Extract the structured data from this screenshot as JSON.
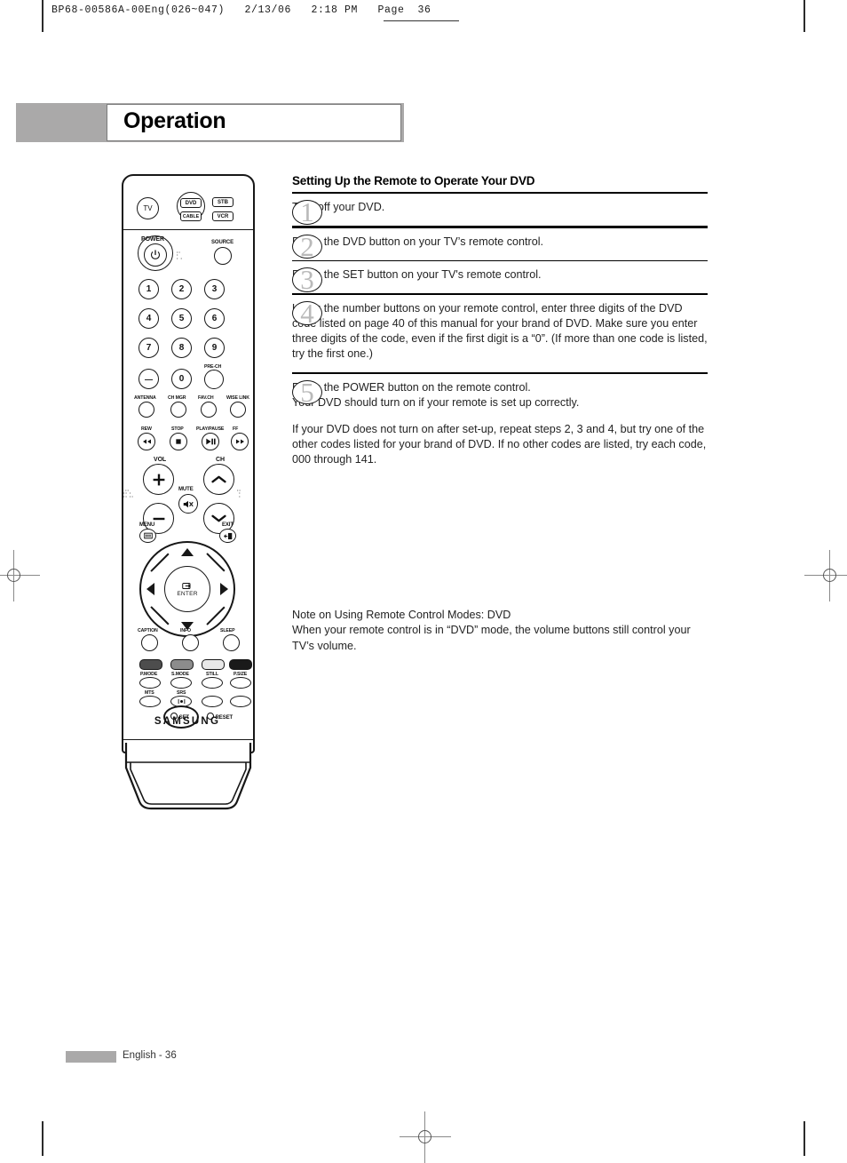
{
  "print_slug": {
    "text": "BP68-00586A-00Eng(026~047)   2/13/06   2:18 PM   Page  36"
  },
  "chapter": {
    "title": "Operation"
  },
  "section": {
    "heading": "Setting Up the Remote to Operate Your DVD",
    "steps": [
      {
        "number": "1",
        "paragraphs": [
          "Turn off your DVD."
        ]
      },
      {
        "number": "2",
        "paragraphs": [
          "Press the DVD button on your TV’s remote control."
        ]
      },
      {
        "number": "3",
        "paragraphs": [
          "Press the SET button on your TV's remote control."
        ]
      },
      {
        "number": "4",
        "paragraphs": [
          "Using the number buttons on your remote control, enter three digits of the DVD code listed on page 40 of this manual for your brand of DVD. Make sure you enter three digits of the code, even if the first digit is a “0”. (If more than one code is listed, try the first one.)"
        ]
      },
      {
        "number": "5",
        "paragraphs": [
          "Press the POWER button on the remote control.\nYour DVD should turn on if your remote is set up correctly.",
          "If your DVD does not turn on after set-up, repeat steps 2, 3 and 4, but try one of the other codes listed for your brand of DVD. If no other codes are listed, try each code, 000 through 141."
        ]
      }
    ]
  },
  "note": {
    "line1": "Note on Using Remote Control Modes: DVD",
    "line2": "When your remote control is in “DVD” mode, the volume buttons still control your TV’s volume."
  },
  "footer": {
    "page_label": "English - 36"
  },
  "remote": {
    "brand": "SAMSUNG",
    "mode_buttons": {
      "tv": "TV",
      "dvd": "DVD",
      "stb": "STB",
      "cable": "CABLE",
      "vcr": "VCR"
    },
    "power": {
      "label": "POWER",
      "icon": "power-icon"
    },
    "source": {
      "label": "SOURCE"
    },
    "keypad": [
      "1",
      "2",
      "3",
      "4",
      "5",
      "6",
      "7",
      "8",
      "9"
    ],
    "keypad_extra": {
      "minus": "—",
      "zero": "0",
      "prech": "PRE-CH"
    },
    "row_antenna": [
      "ANTENNA",
      "CH MGR",
      "FAV.CH",
      "WISE LINK"
    ],
    "row_transport": [
      "REW",
      "STOP",
      "PLAY/PAUSE",
      "FF"
    ],
    "volume": {
      "label": "VOL",
      "up": "+",
      "down": "–"
    },
    "channel": {
      "label": "CH",
      "up": "▲",
      "down": "▼"
    },
    "mute": {
      "label": "MUTE",
      "icon": "mute-icon"
    },
    "menu": {
      "label": "MENU",
      "icon": "menu-icon"
    },
    "exit": {
      "label": "EXIT",
      "icon": "exit-icon"
    },
    "enter": {
      "label": "ENTER",
      "icon": "enter-icon"
    },
    "row_caption": [
      "CAPTION",
      "INFO",
      "SLEEP"
    ],
    "color_buttons": [
      "#4d4d4d",
      "#8c8c8c",
      "#e8e8e8",
      "#1a1a1a"
    ],
    "row_mode": [
      "P.MODE",
      "S.MODE",
      "STILL",
      "P.SIZE"
    ],
    "row_audio": [
      "MTS",
      "SRS"
    ],
    "setup": {
      "set": "SET",
      "reset": "RESET"
    }
  },
  "colors": {
    "chapter_bar": "#aaa9a9",
    "step_number": "#b9b9b9",
    "rule": "#000000",
    "text": "#232323"
  }
}
